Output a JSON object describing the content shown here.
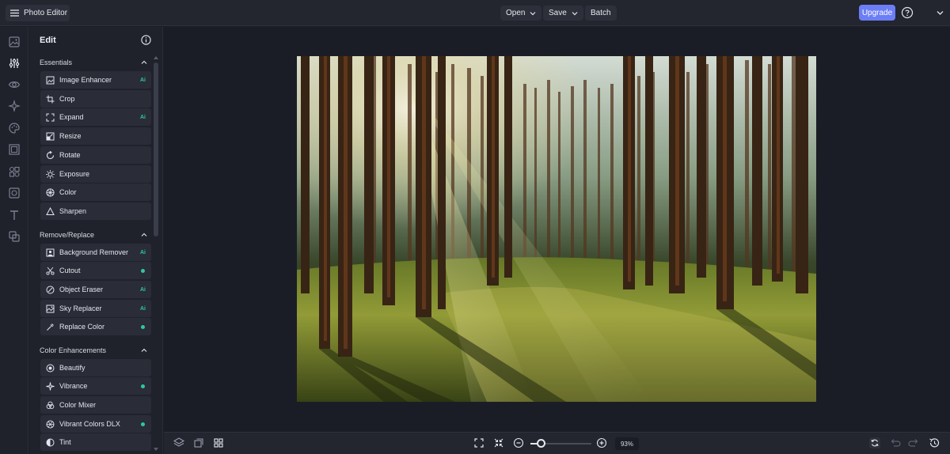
{
  "app": {
    "title": "Photo Editor"
  },
  "topbar": {
    "open_label": "Open",
    "save_label": "Save",
    "batch_label": "Batch",
    "upgrade_label": "Upgrade"
  },
  "rail": {
    "icons": [
      "image-icon",
      "sliders-icon",
      "eye-icon",
      "sparkle-icon",
      "palette-icon",
      "frame-icon",
      "elements-icon",
      "overlay-icon",
      "text-icon",
      "layers-copy-icon"
    ],
    "active_index": 1
  },
  "panel": {
    "title": "Edit",
    "sections": [
      {
        "heading": "Essentials",
        "tools": [
          {
            "label": "Image Enhancer",
            "badge": "Ai",
            "icon": "image-enhancer-icon"
          },
          {
            "label": "Crop",
            "badge": "",
            "icon": "crop-icon"
          },
          {
            "label": "Expand",
            "badge": "Ai",
            "icon": "expand-icon"
          },
          {
            "label": "Resize",
            "badge": "",
            "icon": "resize-icon"
          },
          {
            "label": "Rotate",
            "badge": "",
            "icon": "rotate-icon"
          },
          {
            "label": "Exposure",
            "badge": "",
            "icon": "exposure-icon"
          },
          {
            "label": "Color",
            "badge": "",
            "icon": "color-icon"
          },
          {
            "label": "Sharpen",
            "badge": "",
            "icon": "sharpen-icon"
          }
        ]
      },
      {
        "heading": "Remove/Replace",
        "tools": [
          {
            "label": "Background Remover",
            "badge": "Ai",
            "icon": "background-remover-icon"
          },
          {
            "label": "Cutout",
            "badge": "dot",
            "icon": "cutout-icon"
          },
          {
            "label": "Object Eraser",
            "badge": "Ai",
            "icon": "object-eraser-icon"
          },
          {
            "label": "Sky Replacer",
            "badge": "Ai",
            "icon": "sky-replacer-icon"
          },
          {
            "label": "Replace Color",
            "badge": "dot",
            "icon": "replace-color-icon"
          }
        ]
      },
      {
        "heading": "Color Enhancements",
        "tools": [
          {
            "label": "Beautify",
            "badge": "",
            "icon": "beautify-icon"
          },
          {
            "label": "Vibrance",
            "badge": "dot",
            "icon": "vibrance-icon"
          },
          {
            "label": "Color Mixer",
            "badge": "",
            "icon": "color-mixer-icon"
          },
          {
            "label": "Vibrant Colors DLX",
            "badge": "dot",
            "icon": "vibrant-colors-icon"
          },
          {
            "label": "Tint",
            "badge": "",
            "icon": "tint-icon"
          }
        ]
      }
    ]
  },
  "bottombar": {
    "zoom_label": "93%",
    "zoom_fraction": 0.18
  },
  "colors": {
    "accent": "#6c7ef5",
    "badge": "#2ec7a3",
    "background": "#1b1d26",
    "panel": "#1f212b",
    "tool": "#2a2c37"
  }
}
